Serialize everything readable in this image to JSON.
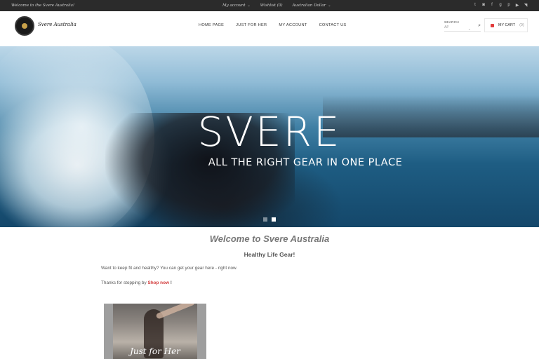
{
  "topbar": {
    "welcome": "Welcome to the Svere Australia!",
    "links": [
      {
        "label": "My account",
        "caret": "⌄"
      },
      {
        "label": "Wishlist (0)"
      },
      {
        "label": "Australian Dollar",
        "caret": "⌄"
      }
    ],
    "social_icons": [
      "twitter-icon",
      "instagram-icon",
      "facebook-icon",
      "google-plus-icon",
      "pinterest-icon",
      "youtube-icon",
      "rss-icon"
    ]
  },
  "header": {
    "logo_text": "Svere Australia",
    "nav": [
      "HOME PAGE",
      "JUST FOR HER",
      "MY ACCOUNT",
      "CONTACT US"
    ],
    "search": {
      "label": "SEARCH",
      "value": "All"
    },
    "cart": {
      "label": "MY CART",
      "count": "(0)"
    }
  },
  "hero": {
    "title": "SVERE",
    "subtitle": "ALL THE RIGHT GEAR IN ONE PLACE",
    "slides": 2,
    "active_slide": 2
  },
  "content": {
    "welcome_title": "Welcome to Svere Australia",
    "tagline": "Healthy Life Gear!",
    "paragraph1": "Want to keep fit and healthy? You can get your gear here - right now.",
    "paragraph2_prefix": "Thanks for stopping by",
    "paragraph2_link": "Shop now",
    "paragraph2_suffix": "!",
    "promo_label": "Just for Her"
  },
  "colors": {
    "topbar_bg": "#2b2b2b",
    "accent": "#d23a3a"
  }
}
